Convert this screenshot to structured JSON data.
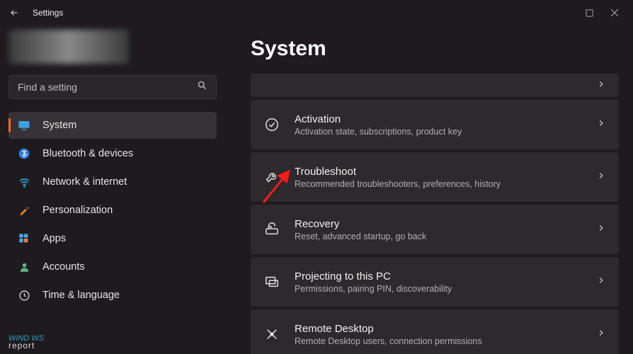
{
  "titlebar": {
    "title": "Settings"
  },
  "search": {
    "placeholder": "Find a setting"
  },
  "nav": {
    "items": [
      {
        "label": "System"
      },
      {
        "label": "Bluetooth & devices"
      },
      {
        "label": "Network & internet"
      },
      {
        "label": "Personalization"
      },
      {
        "label": "Apps"
      },
      {
        "label": "Accounts"
      },
      {
        "label": "Time & language"
      }
    ]
  },
  "main": {
    "heading": "System",
    "cards": [
      {
        "title": "Activation",
        "sub": "Activation state, subscriptions, product key"
      },
      {
        "title": "Troubleshoot",
        "sub": "Recommended troubleshooters, preferences, history"
      },
      {
        "title": "Recovery",
        "sub": "Reset, advanced startup, go back"
      },
      {
        "title": "Projecting to this PC",
        "sub": "Permissions, pairing PIN, discoverability"
      },
      {
        "title": "Remote Desktop",
        "sub": "Remote Desktop users, connection permissions"
      }
    ]
  },
  "watermark": {
    "line1": "WIND WS",
    "line2": "report"
  }
}
